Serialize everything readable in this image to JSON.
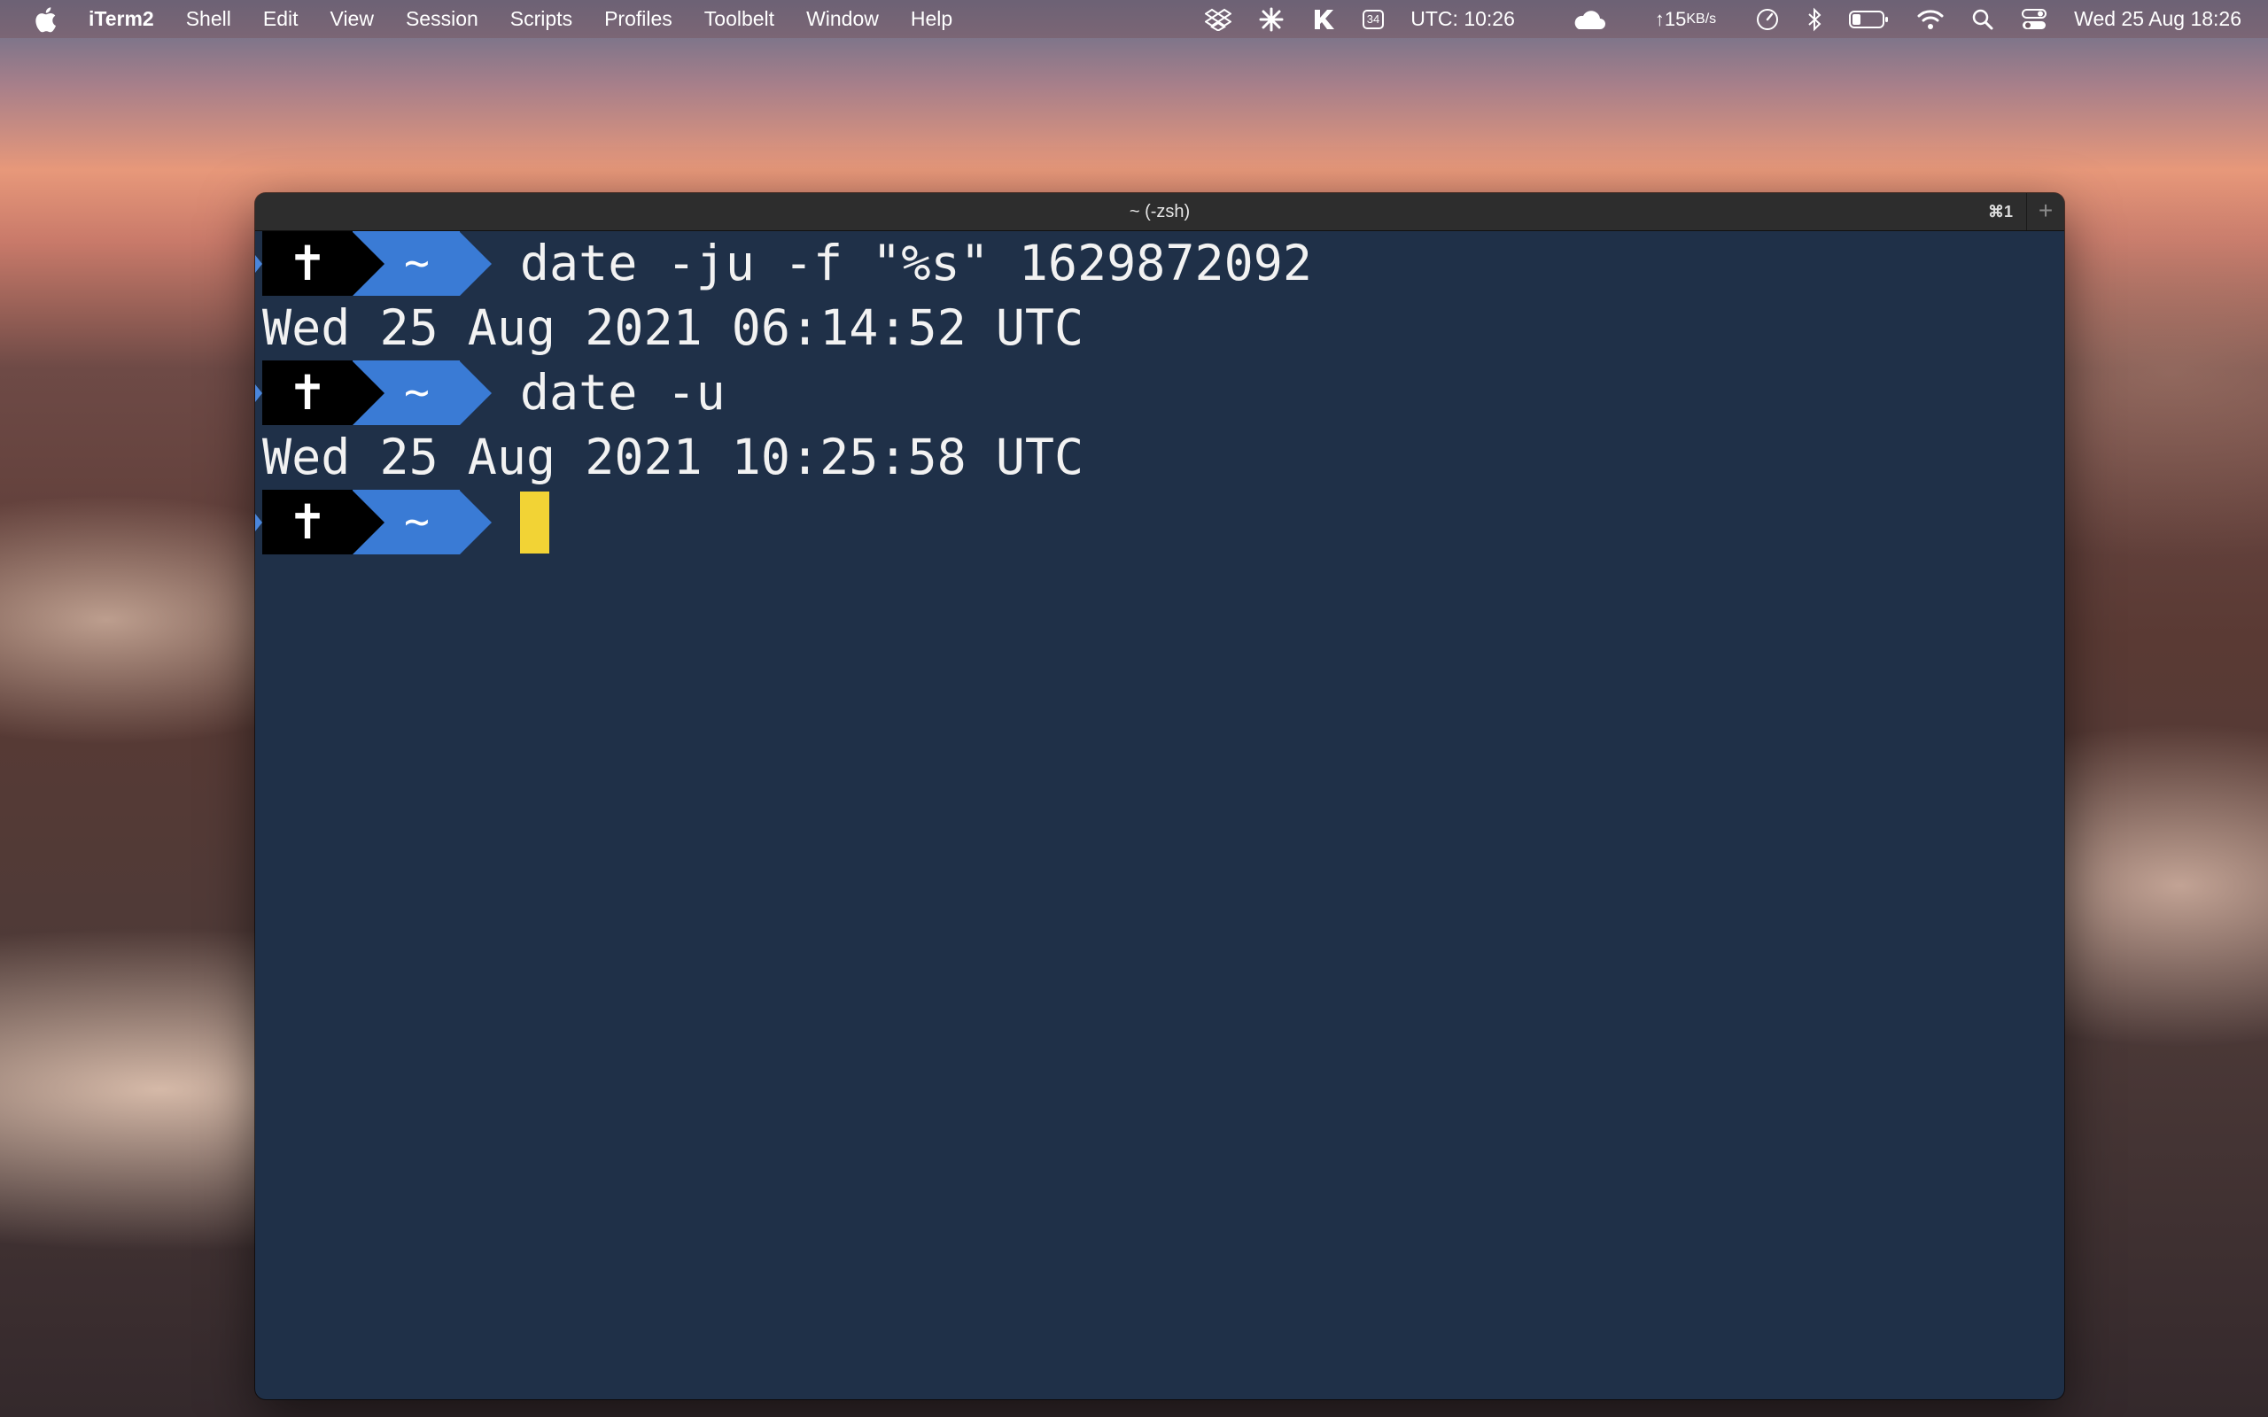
{
  "menubar": {
    "apple_icon": "apple-logo-icon",
    "app_name": "iTerm2",
    "items": [
      "Shell",
      "Edit",
      "View",
      "Session",
      "Scripts",
      "Profiles",
      "Toolbelt",
      "Window",
      "Help"
    ],
    "status": {
      "badge": "34",
      "utc_clock": "UTC: 10:26",
      "network_rate": "↑15",
      "network_unit": "KB/s",
      "datetime": "Wed 25 Aug  18:26"
    },
    "status_icons": [
      "dropbox-icon",
      "pinwheel-icon",
      "k-app-icon",
      "badge-34-icon",
      "weather-cloud-icon",
      "speedometer-icon",
      "bluetooth-icon",
      "battery-icon",
      "wifi-icon",
      "spotlight-search-icon",
      "control-center-icon"
    ]
  },
  "window": {
    "title": "~ (-zsh)",
    "shortcut": "⌘1",
    "new_tab": "+"
  },
  "terminal": {
    "prompt_symbol": "✝",
    "prompt_dir": "~",
    "lines": [
      {
        "type": "prompt",
        "command": "date -ju -f \"%s\" 1629872092"
      },
      {
        "type": "output",
        "text": "Wed 25 Aug 2021 06:14:52 UTC"
      },
      {
        "type": "prompt",
        "command": "date -u"
      },
      {
        "type": "output",
        "text": "Wed 25 Aug 2021 10:25:58 UTC"
      },
      {
        "type": "prompt",
        "command": ""
      }
    ]
  },
  "colors": {
    "terminal_bg": "#1f3048",
    "prompt_blue": "#3a7bd5",
    "cursor": "#f2d335"
  }
}
